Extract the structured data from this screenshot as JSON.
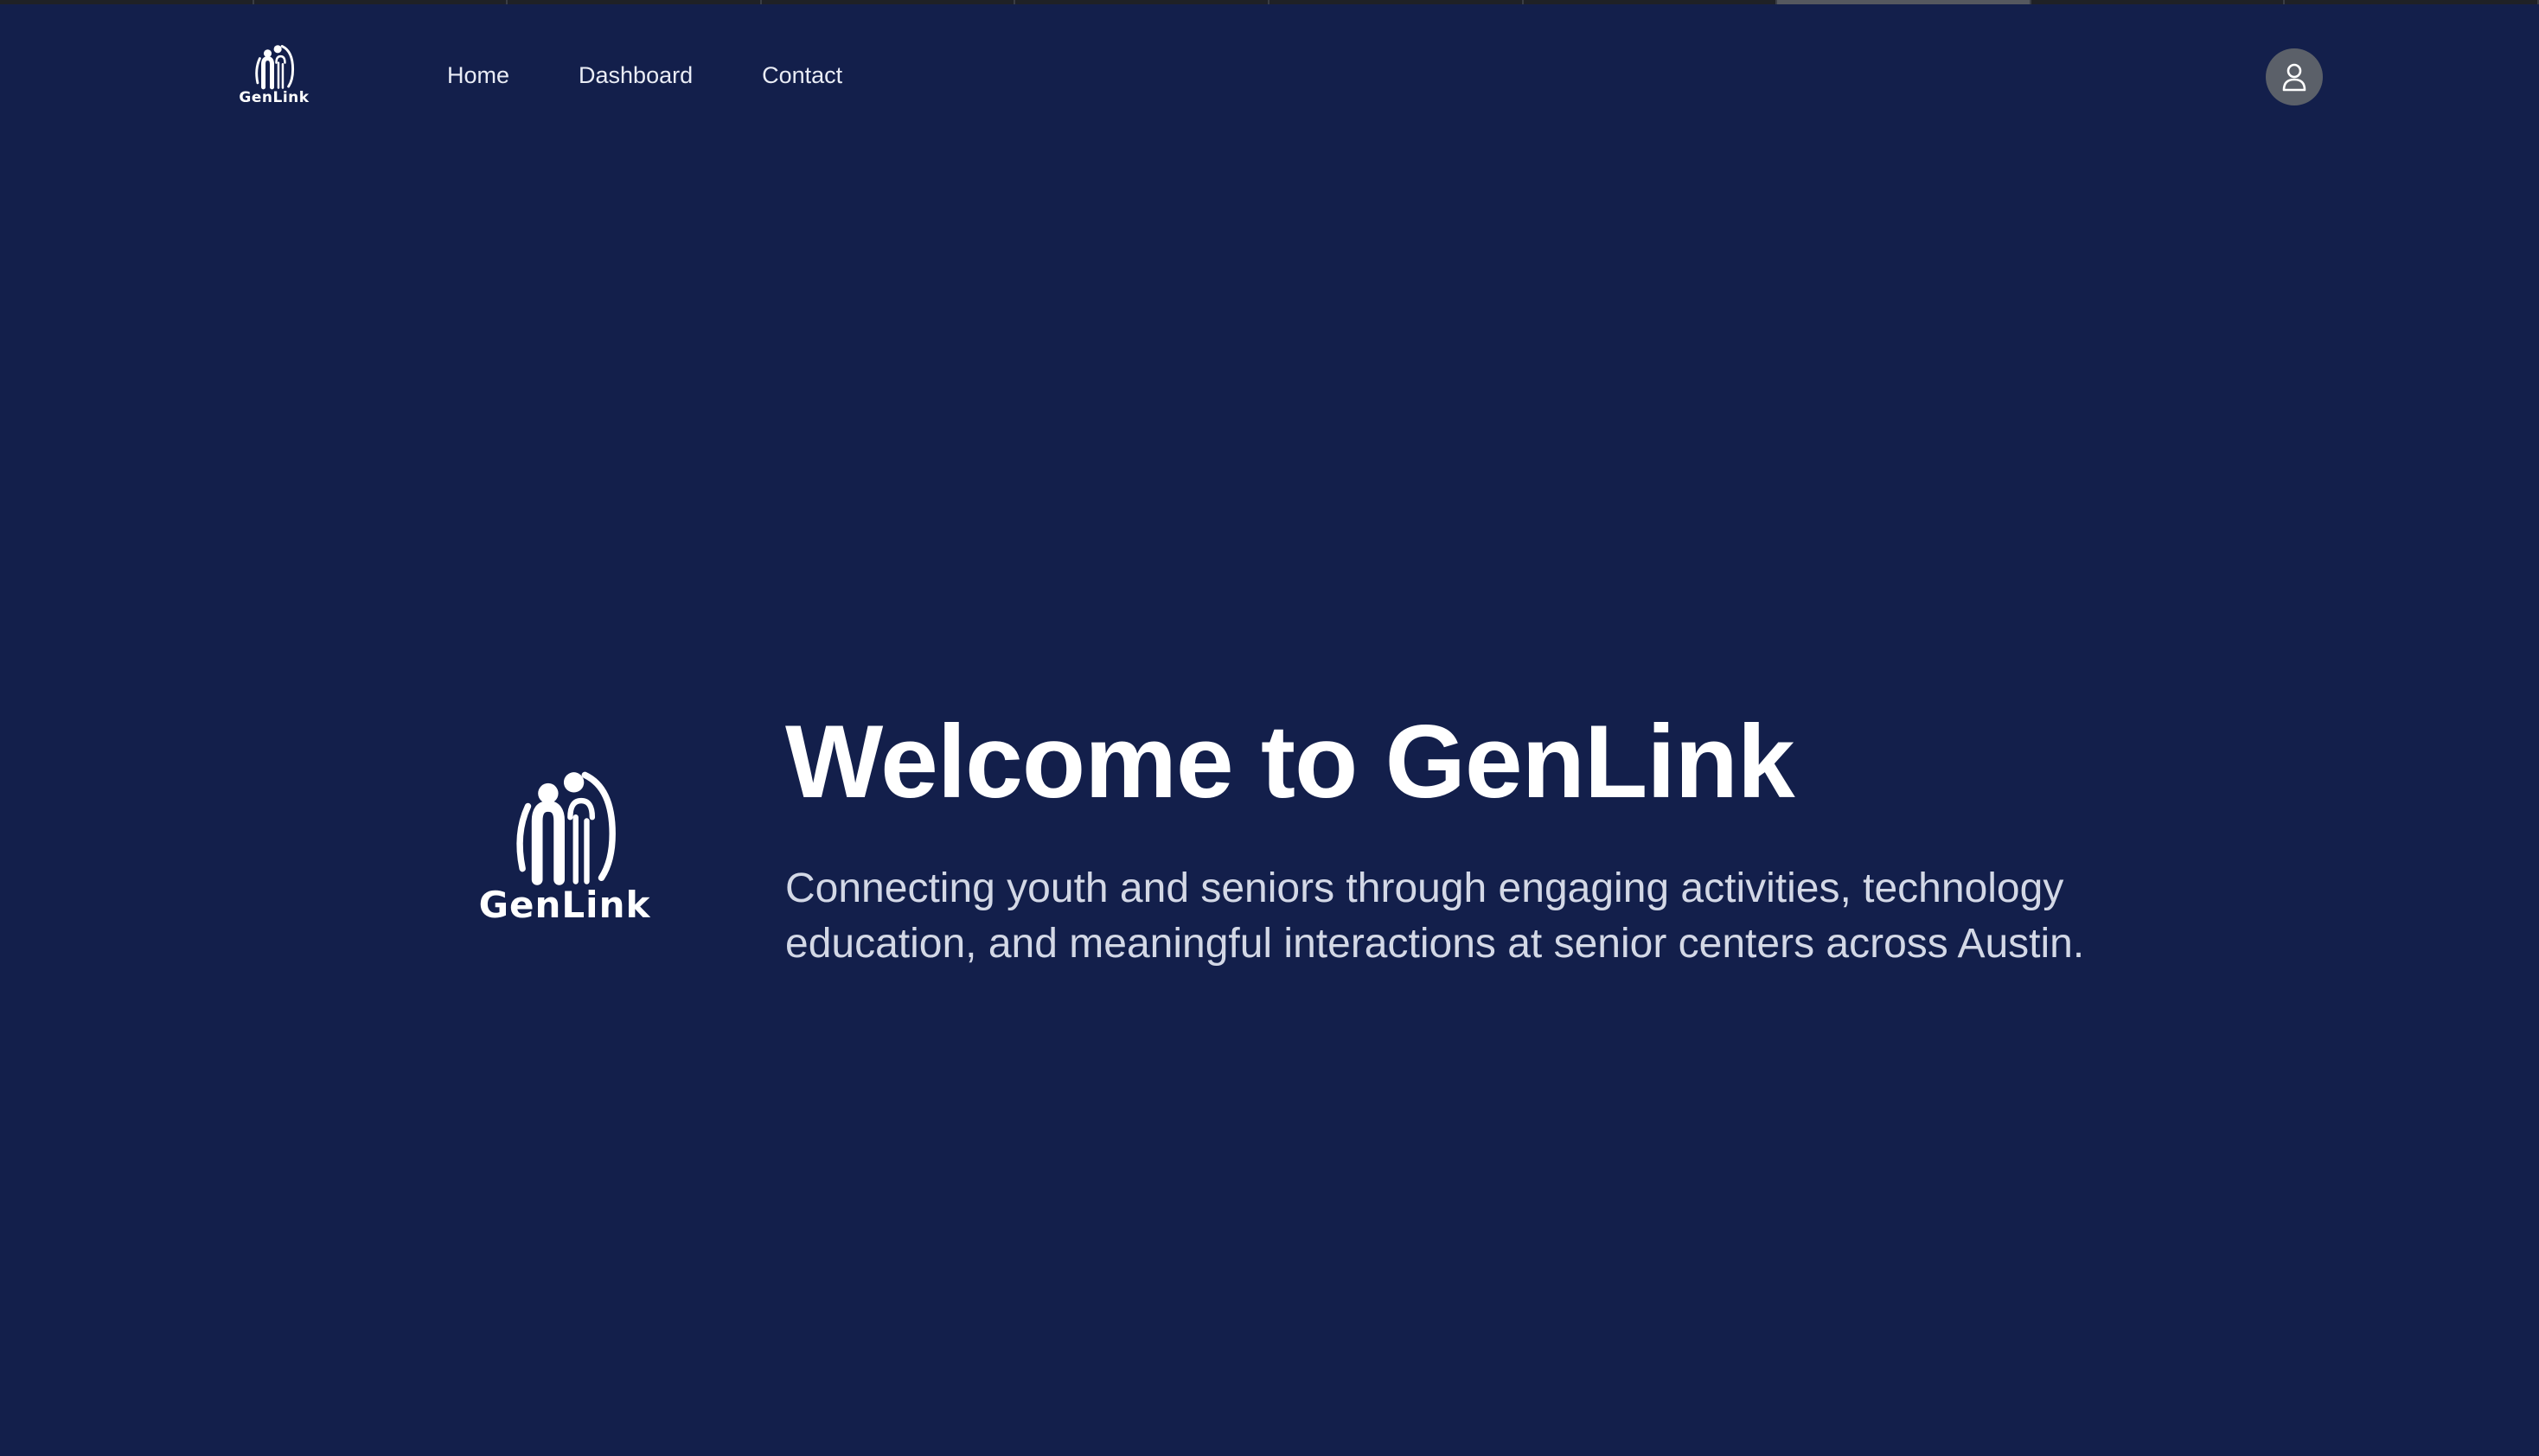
{
  "colors": {
    "background": "#131f4b",
    "text_primary": "#ffffff",
    "text_secondary": "#d3d8e6",
    "avatar_bg": "#5b6069"
  },
  "brand": {
    "name": "GenLink",
    "logo_icon": "genlink-logo-icon"
  },
  "nav": {
    "items": [
      {
        "label": "Home"
      },
      {
        "label": "Dashboard"
      },
      {
        "label": "Contact"
      }
    ],
    "profile_icon": "user-icon"
  },
  "hero": {
    "title": "Welcome to GenLink",
    "subtitle": "Connecting youth and seniors through engaging activities, technology education, and meaningful interactions at senior centers across Austin."
  }
}
